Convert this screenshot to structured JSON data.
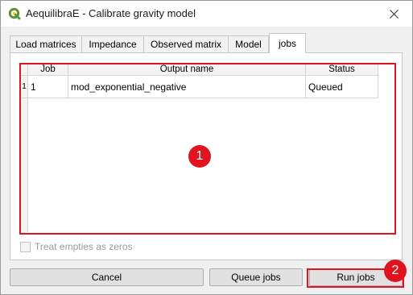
{
  "window": {
    "title": "AequilibraE - Calibrate gravity model"
  },
  "tabs": [
    {
      "label": "Load matrices"
    },
    {
      "label": "Impedance"
    },
    {
      "label": "Observed matrix"
    },
    {
      "label": "Model"
    },
    {
      "label": "jobs"
    }
  ],
  "table": {
    "columns": [
      "Job",
      "Output name",
      "Status"
    ],
    "rows": [
      {
        "row_number": "1",
        "job": "1",
        "output_name": "mod_exponential_negative",
        "status": "Queued"
      }
    ]
  },
  "options": {
    "treat_empties_label": "Treat empties as zeros"
  },
  "buttons": {
    "cancel": "Cancel",
    "queue_jobs": "Queue jobs",
    "run_jobs": "Run jobs"
  },
  "annotations": {
    "marker_1": "1",
    "marker_2": "2"
  },
  "colors": {
    "annotation_red": "#e0141e",
    "qgis_green": "#589632"
  }
}
